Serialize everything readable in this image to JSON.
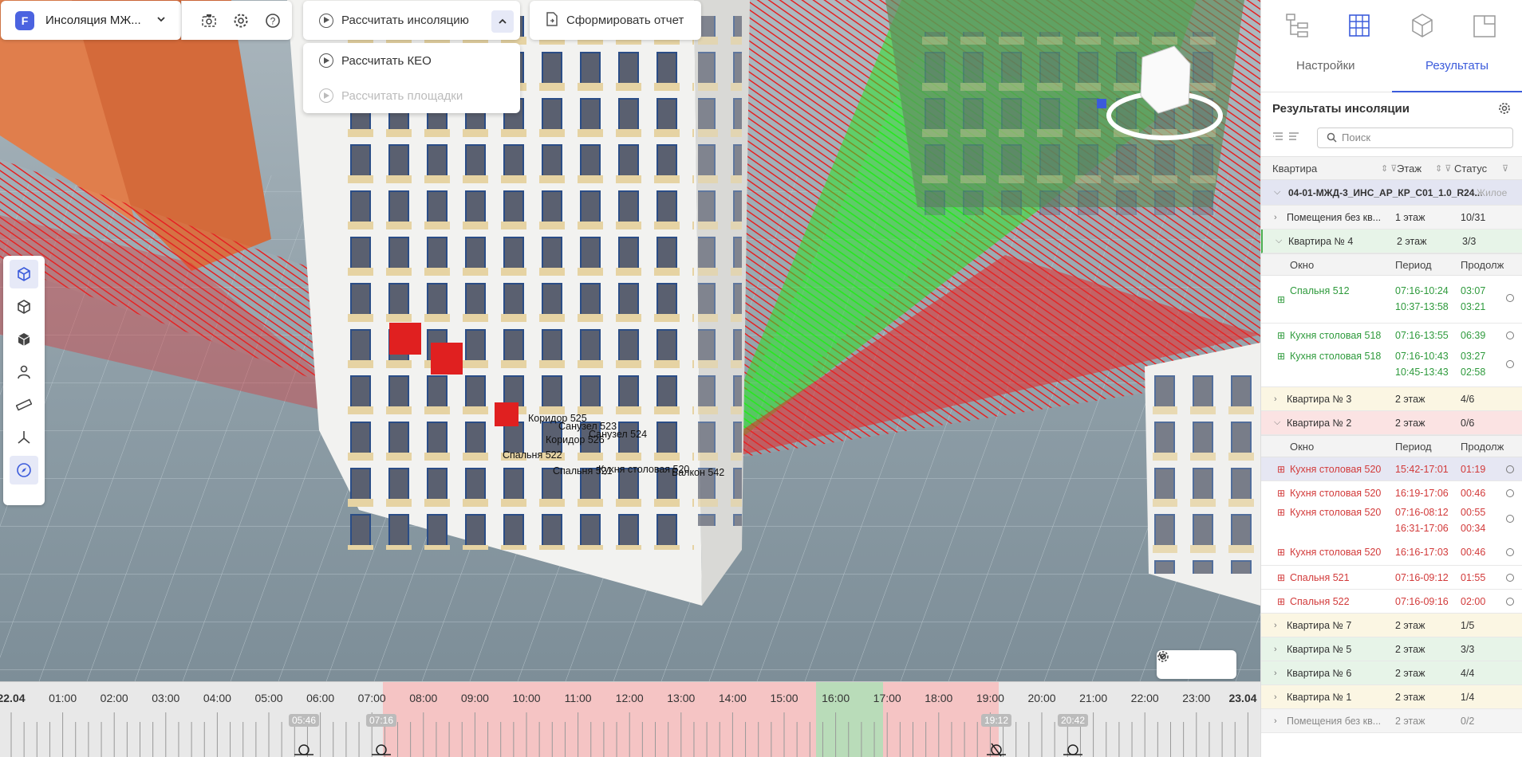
{
  "toolbar": {
    "project_title": "Инсоляция МЖ...",
    "calc_insolation": "Рассчитать инсоляцию",
    "report": "Сформировать отчет",
    "dropdown": [
      {
        "label": "Рассчитать КЕО",
        "disabled": false
      },
      {
        "label": "Рассчитать площадки",
        "disabled": true
      }
    ]
  },
  "scene_labels": [
    "Коридор 525",
    "Санузел 523",
    "Санузел 524",
    "Коридор 526",
    "Спальня 522",
    "Спальня 521",
    "Кухня столовая 520",
    "Балкон 542"
  ],
  "left_tools": [
    "3d-view-icon",
    "cube-outline-icon",
    "cube-solid-icon",
    "person-icon",
    "ruler-icon",
    "axes-icon",
    "compass-icon"
  ],
  "panel": {
    "tabs": {
      "settings": "Настройки",
      "results": "Результаты"
    },
    "heading": "Результаты инсоляции",
    "search_placeholder": "Поиск",
    "col_apartment": "Квартира",
    "col_floor": "Этаж",
    "col_status": "Статус",
    "win_col_window": "Окно",
    "win_col_period": "Период",
    "win_col_duration": "Продолж",
    "root": {
      "name": "04-01-МЖД-3_ИНС_АР_КР_С01_1.0_R24...",
      "type": "Жилое"
    },
    "rows": [
      {
        "name": "Помещения без кв...",
        "floor": "1 этаж",
        "status": "10/31"
      },
      {
        "name": "Квартира № 4",
        "floor": "2 этаж",
        "status": "3/3"
      },
      {
        "name": "Квартира № 3",
        "floor": "2 этаж",
        "status": "4/6"
      },
      {
        "name": "Квартира № 2",
        "floor": "2 этаж",
        "status": "0/6"
      },
      {
        "name": "Квартира № 7",
        "floor": "2 этаж",
        "status": "1/5"
      },
      {
        "name": "Квартира № 5",
        "floor": "2 этаж",
        "status": "3/3"
      },
      {
        "name": "Квартира № 6",
        "floor": "2 этаж",
        "status": "4/4"
      },
      {
        "name": "Квартира № 1",
        "floor": "2 этаж",
        "status": "1/4"
      },
      {
        "name": "Помещения без кв...",
        "floor": "2 этаж",
        "status": "0/2"
      }
    ],
    "apt4_windows": [
      {
        "name": "Спальня 512",
        "p1": "07:16-10:24",
        "d1": "03:07",
        "p2": "10:37-13:58",
        "d2": "03:21"
      },
      {
        "name": "Кухня столовая 518",
        "p1": "07:16-13:55",
        "d1": "06:39",
        "p2": "",
        "d2": ""
      },
      {
        "name": "Кухня столовая 518",
        "p1": "07:16-10:43",
        "d1": "03:27",
        "p2": "10:45-13:43",
        "d2": "02:58"
      }
    ],
    "apt2_windows": [
      {
        "name": "Кухня столовая 520",
        "p1": "15:42-17:01",
        "d1": "01:19",
        "p2": "",
        "d2": ""
      },
      {
        "name": "Кухня столовая 520",
        "p1": "16:19-17:06",
        "d1": "00:46",
        "p2": "",
        "d2": ""
      },
      {
        "name": "Кухня столовая 520",
        "p1": "07:16-08:12",
        "d1": "00:55",
        "p2": "16:31-17:06",
        "d2": "00:34"
      },
      {
        "name": "Кухня столовая 520",
        "p1": "16:16-17:03",
        "d1": "00:46",
        "p2": "",
        "d2": ""
      },
      {
        "name": "Спальня 521",
        "p1": "07:16-09:12",
        "d1": "01:55",
        "p2": "",
        "d2": ""
      },
      {
        "name": "Спальня 522",
        "p1": "07:16-09:16",
        "d1": "02:00",
        "p2": "",
        "d2": ""
      }
    ]
  },
  "timeline": {
    "start": "22.04",
    "end": "23.04",
    "hours": [
      "01:00",
      "02:00",
      "03:00",
      "04:00",
      "05:00",
      "06:00",
      "07:00",
      "08:00",
      "09:00",
      "10:00",
      "11:00",
      "12:00",
      "13:00",
      "14:00",
      "15:00",
      "16:00",
      "17:00",
      "18:00",
      "19:00",
      "20:00",
      "21:00",
      "22:00",
      "23:00"
    ],
    "sunrise": "05:46",
    "calc_start": "07:16",
    "calc_end": "19:12",
    "sunset": "20:42",
    "colors": {
      "red": "#f5c4c4",
      "green": "#b9dcb9"
    }
  }
}
